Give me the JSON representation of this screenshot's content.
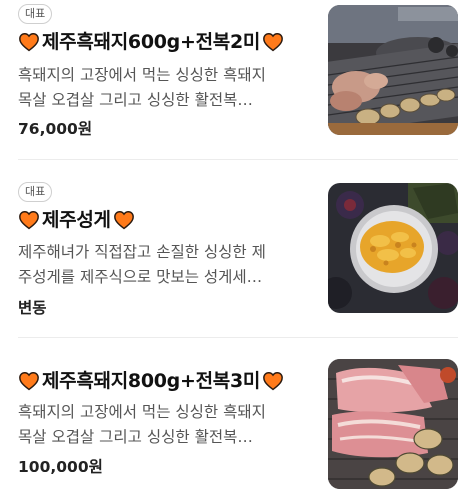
{
  "colors": {
    "heart": "#ff7a1a",
    "heart_outline": "#2a1a10",
    "text_primary": "#111111",
    "text_secondary": "#555555",
    "badge_border": "#cfcfcf",
    "divider": "#ececec"
  },
  "menu": {
    "items": [
      {
        "badge": "대표",
        "title": "제주흑돼지600g+전복2미",
        "description_line1": "흑돼지의 고장에서 먹는 싱싱한 흑돼지",
        "description_line2": "목살 오겹살 그리고 싱싱한 활전복…",
        "price": "76,000원",
        "icon": "heart-icon",
        "image": "grilled-pork-abalone-photo"
      },
      {
        "badge": "대표",
        "title": "제주성게",
        "description_line1": "제주해녀가 직접잡고 손질한 싱싱한 제",
        "description_line2": "주성게를 제주식으로 맛보는 성게세…",
        "price": "변동",
        "icon": "heart-icon",
        "image": "sea-urchin-plate-photo"
      },
      {
        "badge": "",
        "title": "제주흑돼지800g+전복3미",
        "description_line1": "흑돼지의 고장에서 먹는 싱싱한 흑돼지",
        "description_line2": "목살 오겹살 그리고 싱싱한 활전복…",
        "price": "100,000원",
        "icon": "heart-icon",
        "image": "raw-pork-abalone-photo"
      }
    ]
  }
}
